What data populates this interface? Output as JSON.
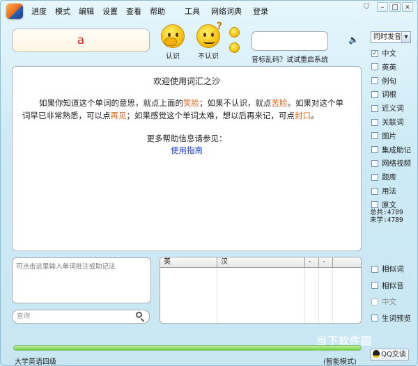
{
  "menu": [
    "进度",
    "模式",
    "编辑",
    "设置",
    "查看",
    "帮助"
  ],
  "menu_extra": [
    "工具",
    "网络词典",
    "登录"
  ],
  "word": "a",
  "buttons": {
    "know": "认识",
    "dont_know": "不认识"
  },
  "phonetic_link": "音标乱码？试试重启系统",
  "welcome": {
    "title": "欢迎使用词汇之沙",
    "p1_a": "如果你知道这个单词的意思，就点上面的",
    "p1_smile": "笑脸",
    "p1_b": "；如果不认识，就点",
    "p1_bitter": "苦脸",
    "p1_c": "。如果对这个单词早已非常熟悉，可以点",
    "p1_seen": "再见",
    "p1_d": "；如果感觉这个单词太难，想以后再来记，可点",
    "p1_seal": "封口",
    "p1_e": "。",
    "more": "更多帮助信息请参见：",
    "guide": "使用指南"
  },
  "mode_select": "同时发音",
  "options": [
    {
      "label": "中文",
      "checked": true
    },
    {
      "label": "英英",
      "checked": false
    },
    {
      "label": "例句",
      "checked": false
    },
    {
      "label": "词根",
      "checked": false
    },
    {
      "label": "近义词",
      "checked": false
    },
    {
      "label": "关联词",
      "checked": false
    },
    {
      "label": "图片",
      "checked": false
    },
    {
      "label": "集成助记",
      "checked": false
    },
    {
      "label": "网络视频",
      "checked": false
    },
    {
      "label": "题库",
      "checked": false
    },
    {
      "label": "用法",
      "checked": false
    },
    {
      "label": "原文",
      "checked": false
    }
  ],
  "stats": {
    "total": "总共:4789",
    "unlearned": "未学:4789"
  },
  "bottom_options": [
    {
      "label": "相似词",
      "checked": false,
      "disabled": false
    },
    {
      "label": "相似音",
      "checked": false,
      "disabled": false
    },
    {
      "label": "中文",
      "checked": false,
      "disabled": true
    },
    {
      "label": "生词预览",
      "checked": false,
      "disabled": false
    }
  ],
  "note_placeholder": "可点击这里输入单词批注或助记法",
  "search_placeholder": "查询",
  "grid_headers": [
    "英",
    "汉",
    "-",
    "-"
  ],
  "status_left": "大学英语四级",
  "status_right": "(智能模式)",
  "watermark": "当下软件园",
  "qq_label": "QQ交谈"
}
